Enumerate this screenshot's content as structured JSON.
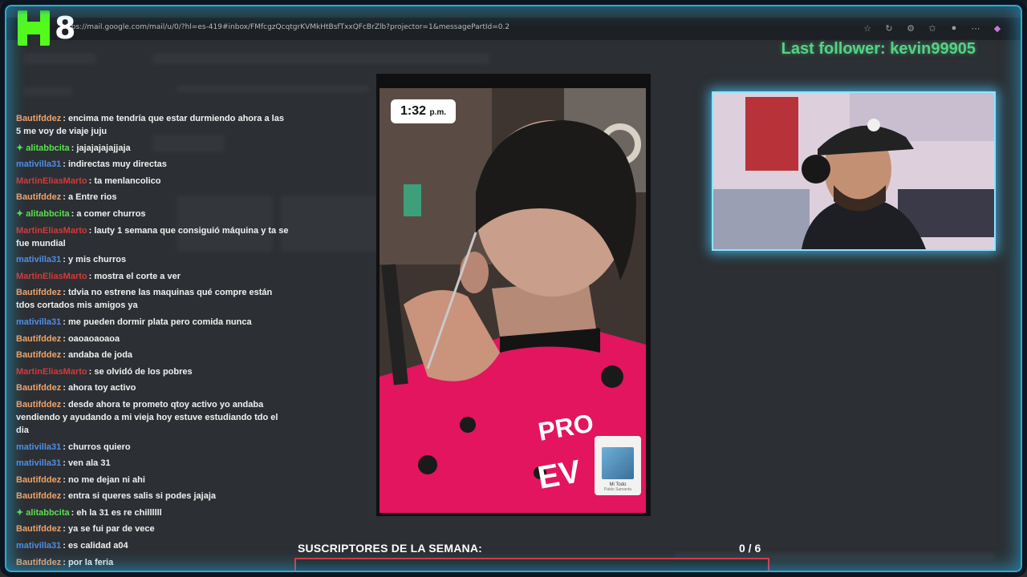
{
  "browser": {
    "url": "https://mail.google.com/mail/u/0/?hl=es-419#inbox/FMfcgzQcqtgrKVMkHtBsfTxxQFcBrZlb?projector=1&messagePartId=0.2"
  },
  "logo": {
    "number": "8"
  },
  "last_follower": "Last follower: kevin99905",
  "chat": [
    {
      "user": "Bautifddez",
      "color": "orange",
      "badge": false,
      "text": ": encima me tendría que estar durmiendo ahora a las 5 me voy de viaje juju"
    },
    {
      "user": "alitabbcita",
      "color": "green",
      "badge": true,
      "text": ": jajajajajajjaja"
    },
    {
      "user": "mativilla31",
      "color": "blue",
      "badge": false,
      "text": ": indirectas muy directas"
    },
    {
      "user": "MartinEliasMarto",
      "color": "red",
      "badge": false,
      "text": ": ta menlancolico"
    },
    {
      "user": "Bautifddez",
      "color": "orange",
      "badge": false,
      "text": ": a Entre rios"
    },
    {
      "user": "alitabbcita",
      "color": "green",
      "badge": true,
      "text": ": a comer churros"
    },
    {
      "user": "MartinEliasMarto",
      "color": "red",
      "badge": false,
      "text": ": lauty 1 semana que consiguió máquina y ta se fue mundial"
    },
    {
      "user": "mativilla31",
      "color": "blue",
      "badge": false,
      "text": ": y mis churros"
    },
    {
      "user": "MartinEliasMarto",
      "color": "red",
      "badge": false,
      "text": ": mostra el corte a ver"
    },
    {
      "user": "Bautifddez",
      "color": "orange",
      "badge": false,
      "text": ": tdvia no estrene las maquinas qué compre están tdos cortados mis amigos ya"
    },
    {
      "user": "mativilla31",
      "color": "blue",
      "badge": false,
      "text": ": me pueden dormir plata pero comida nunca"
    },
    {
      "user": "Bautifddez",
      "color": "orange",
      "badge": false,
      "text": ": oaoaoaoaoa"
    },
    {
      "user": "Bautifddez",
      "color": "orange",
      "badge": false,
      "text": ": andaba de joda"
    },
    {
      "user": "MartinEliasMarto",
      "color": "red",
      "badge": false,
      "text": ": se olvidó de los pobres"
    },
    {
      "user": "Bautifddez",
      "color": "orange",
      "badge": false,
      "text": ": ahora toy activo"
    },
    {
      "user": "Bautifddez",
      "color": "orange",
      "badge": false,
      "text": ": desde ahora te prometo qtoy activo yo andaba vendiendo y ayudando a mi vieja hoy estuve estudiando tdo el dia"
    },
    {
      "user": "mativilla31",
      "color": "blue",
      "badge": false,
      "text": ": churros quiero"
    },
    {
      "user": "mativilla31",
      "color": "blue",
      "badge": false,
      "text": ": ven ala 31"
    },
    {
      "user": "Bautifddez",
      "color": "orange",
      "badge": false,
      "text": ": no me dejan ni ahi"
    },
    {
      "user": "Bautifddez",
      "color": "orange",
      "badge": false,
      "text": ": entra si queres salis si podes jajaja"
    },
    {
      "user": "alitabbcita",
      "color": "green",
      "badge": true,
      "text": ": eh la 31 es re chillllll"
    },
    {
      "user": "Bautifddez",
      "color": "orange",
      "badge": false,
      "text": ": ya se fui par de vece"
    },
    {
      "user": "mativilla31",
      "color": "blue",
      "badge": false,
      "text": ": es calidad a04"
    },
    {
      "user": "Bautifddez",
      "color": "orange",
      "badge": false,
      "text": ": por la feria"
    }
  ],
  "video": {
    "time_hour": "1:32",
    "time_suffix": "p.m.",
    "sticker_title": "Mi Todo",
    "sticker_artist": "Pablo Samanta"
  },
  "subs": {
    "label": "SUSCRIPTORES DE LA SEMANA:",
    "count": "0 / 6",
    "progress": 0
  },
  "colors": {
    "frame": "#2ea9d8",
    "follower": "#58d184",
    "subs_bar": "#e0323c"
  }
}
